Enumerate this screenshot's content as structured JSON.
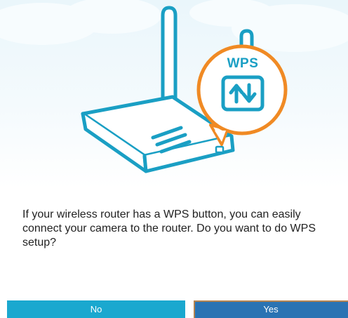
{
  "illustration": {
    "wps_badge_label": "WPS",
    "icons": [
      "router-icon",
      "wps-sync-arrows-icon"
    ],
    "colors": {
      "router_stroke": "#1a9fc4",
      "badge_ring": "#f08a24",
      "sky": "#eaf6fb"
    }
  },
  "prompt": {
    "message": "If your wireless router has a WPS button, you can easily connect your camera to the router. Do you want to do WPS setup?"
  },
  "actions": {
    "no_label": "No",
    "yes_label": "Yes",
    "colors": {
      "no_bg": "#1aa8cf",
      "yes_bg": "#2a73b3",
      "label": "#ffffff"
    }
  }
}
